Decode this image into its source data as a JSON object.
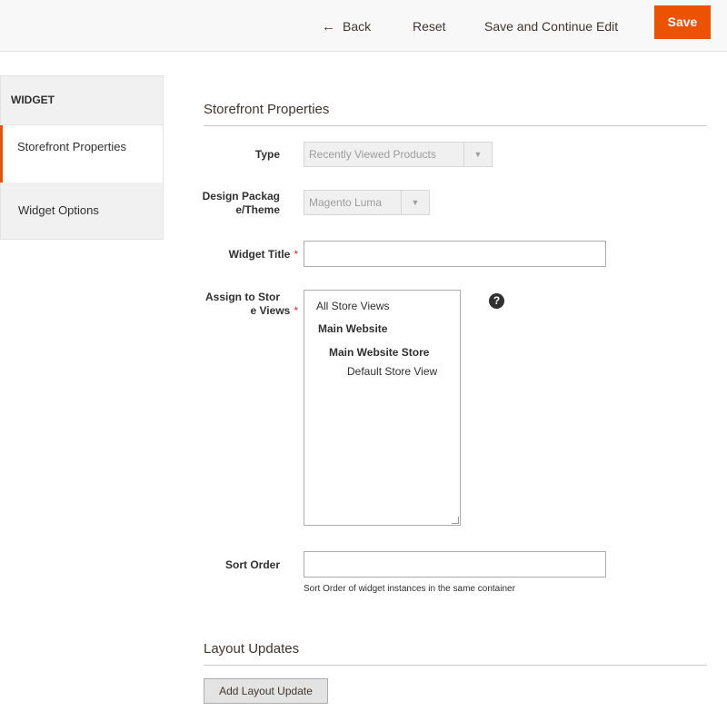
{
  "toolbar": {
    "back_arrow": "←",
    "back_label": "Back",
    "reset_label": "Reset",
    "save_continue_label": "Save and Continue Edit",
    "save_label": "Save"
  },
  "sidebar": {
    "heading": "WIDGET",
    "items": [
      {
        "label": "Storefront Properties",
        "active": true
      },
      {
        "label": "Widget Options",
        "active": false
      }
    ]
  },
  "main": {
    "section_title": "Storefront Properties",
    "fields": {
      "type": {
        "label": "Type",
        "value": "Recently Viewed Products"
      },
      "theme": {
        "label_line1": "Design Packag",
        "label_line2": "e/Theme",
        "value": "Magento Luma"
      },
      "widget_title": {
        "label": "Widget Title",
        "required": "*",
        "value": ""
      },
      "store_views": {
        "label_line1": "Assign to Stor",
        "label_line2": "e Views",
        "required": "*",
        "options": [
          "All Store Views",
          "Main Website",
          "Main Website Store",
          "Default Store View"
        ],
        "help_icon": "?"
      },
      "sort_order": {
        "label": "Sort Order",
        "value": "",
        "note": "Sort Order of widget instances in the same container"
      }
    },
    "layout_section_title": "Layout Updates",
    "add_layout_label": "Add Layout Update"
  },
  "colors": {
    "accent": "#eb5202",
    "required": "#e22626"
  }
}
